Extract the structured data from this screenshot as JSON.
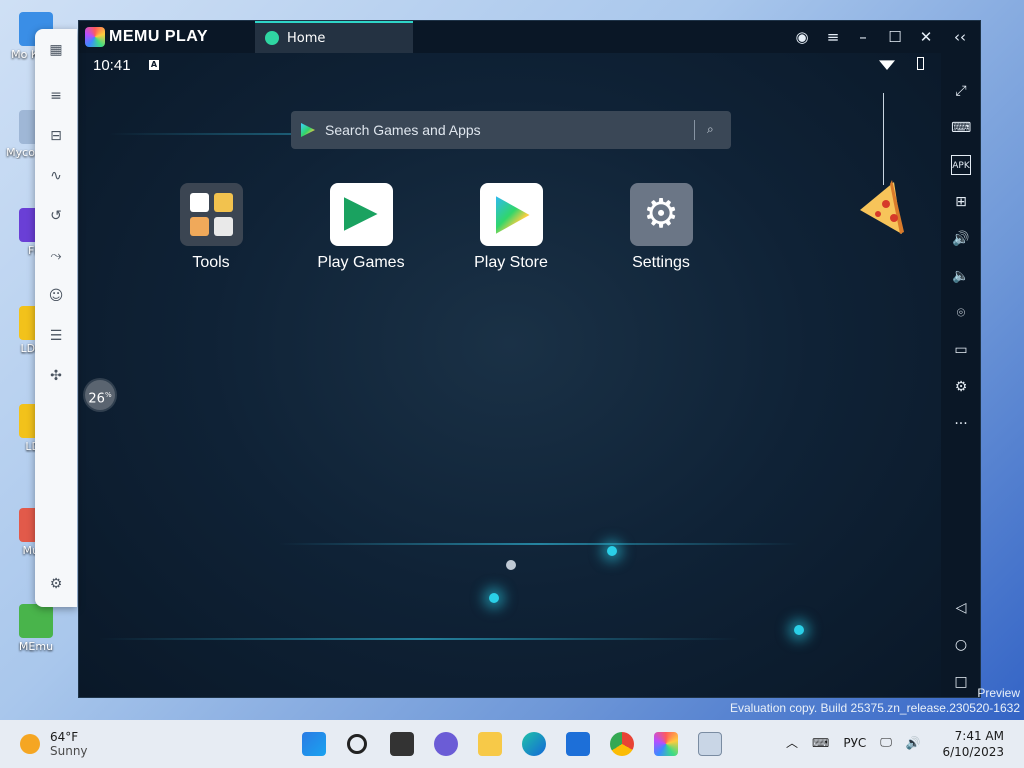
{
  "desktop": {
    "icons": [
      {
        "label": "Мо Комп",
        "color": "#3a8ee6"
      },
      {
        "label": "Мусо Корз",
        "color": "#9fb7d6"
      },
      {
        "label": "Flo",
        "color": "#6a3fd6"
      },
      {
        "label": "LDMu",
        "color": "#f2c21b"
      },
      {
        "label": "LDP",
        "color": "#f2c21b"
      },
      {
        "label": "Multi",
        "color": "#e25a4a"
      },
      {
        "label": "MEmu",
        "color": "#49b44b"
      }
    ]
  },
  "emulator": {
    "brand": "MEMU PLAY",
    "tab_label": "Home",
    "time": "10:41",
    "search_placeholder": "Search Games and Apps",
    "apps": [
      {
        "label": "Tools"
      },
      {
        "label": "Play Games"
      },
      {
        "label": "Play Store"
      },
      {
        "label": "Settings"
      }
    ],
    "progress_percent": "26",
    "progress_sup": "%"
  },
  "watermark": {
    "line1": "Preview",
    "line2": "Evaluation copy. Build 25375.zn_release.230520-1632"
  },
  "taskbar": {
    "weather_temp": "64°F",
    "weather_desc": "Sunny",
    "language": "РУС",
    "time": "7:41 AM",
    "date": "6/10/2023"
  },
  "colors": {
    "accent": "#2fd6c8",
    "window_bg": "#0c1a2b"
  }
}
